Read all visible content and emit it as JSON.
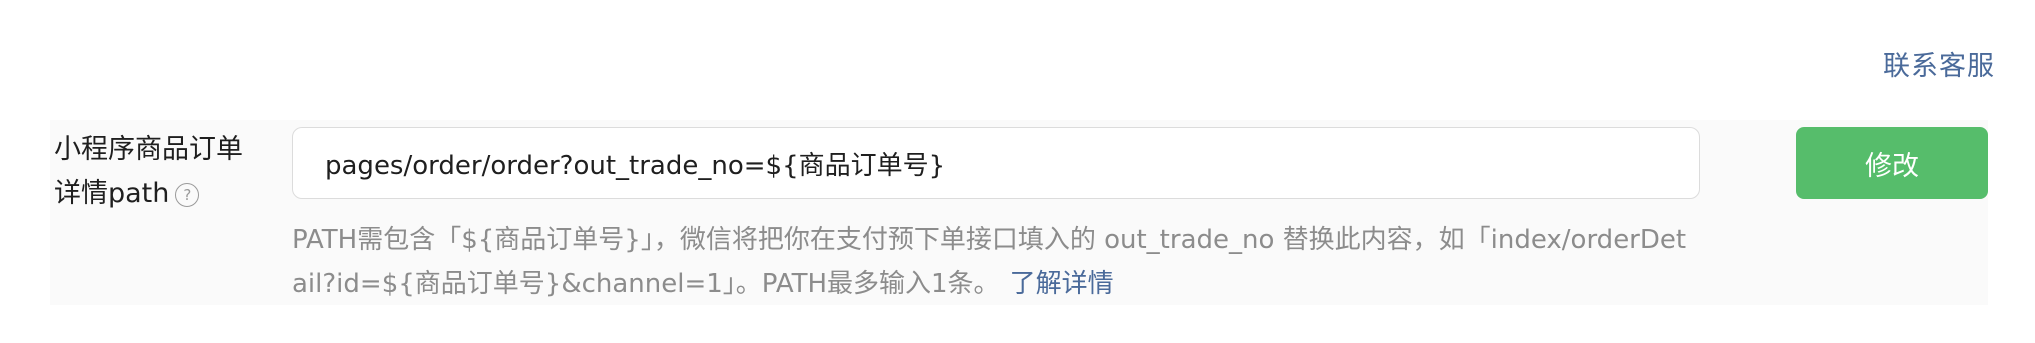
{
  "header": {
    "contact_label": "联系客服"
  },
  "form": {
    "field_label_line1": "小程序商品订单",
    "field_label_line2": "详情path",
    "help_icon": "question-circle-icon",
    "path_value": "pages/order/order?out_trade_no=${商品订单号}",
    "edit_button_label": "修改",
    "hint_text": "PATH需包含「${商品订单号}」，微信将把你在支付预下单接口填入的 out_trade_no 替换此内容，如「index/orderDetail?id=${商品订单号}&channel=1」。PATH最多输入1条。",
    "learn_more_label": "了解详情"
  },
  "colors": {
    "button_green": "#56bd6b",
    "link_blue": "#4a6a9a",
    "hint_gray": "#8c8c8c"
  }
}
